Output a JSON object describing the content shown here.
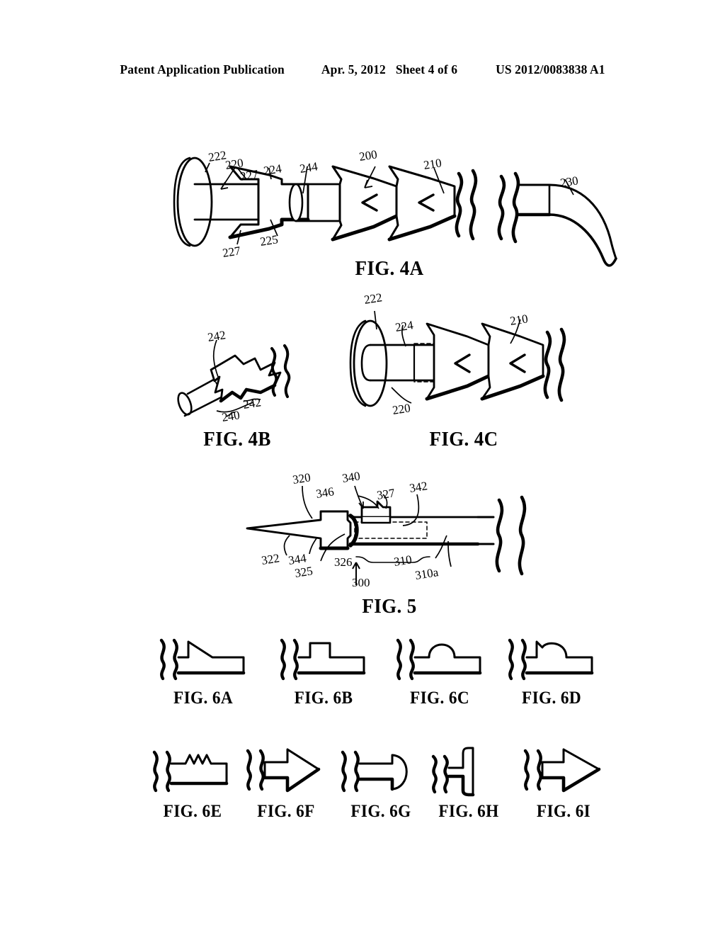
{
  "header": {
    "publication": "Patent Application Publication",
    "date": "Apr. 5, 2012",
    "sheet": "Sheet 4 of 6",
    "patent_number": "US 2012/0083838 A1"
  },
  "document": {
    "type": "patent-drawing-sheet",
    "ink_color": "#000000",
    "background_color": "#ffffff"
  },
  "figures": [
    {
      "id": "fig-4a",
      "caption": "FIG. 4A",
      "description": "Barbed anchor with disc head, shaft and two rearward barbs; separate curved hook element",
      "refs": [
        "222",
        "220",
        "227",
        "224",
        "225",
        "227",
        "244",
        "200",
        "210",
        "230"
      ]
    },
    {
      "id": "fig-4b",
      "caption": "FIG. 4B",
      "description": "Perspective view of barbed tip on a cylindrical shaft",
      "refs": [
        "242",
        "242",
        "240"
      ]
    },
    {
      "id": "fig-4c",
      "caption": "FIG. 4C",
      "description": "Disc head anchor with shaft shown in hidden dashed lines through the barbs",
      "refs": [
        "222",
        "224",
        "220",
        "210"
      ]
    },
    {
      "id": "fig-5",
      "caption": "FIG. 5",
      "description": "Arrow tip anchor with latch tab over an elongated tubular shaft",
      "refs": [
        "320",
        "340",
        "346",
        "327",
        "342",
        "322",
        "344",
        "325",
        "326",
        "300",
        "310",
        "310a"
      ]
    },
    {
      "id": "fig-6a",
      "caption": "FIG. 6A",
      "description": "Ramp / sawtooth profile barb on filament"
    },
    {
      "id": "fig-6b",
      "caption": "FIG. 6B",
      "description": "Rectangular step profile barb on filament"
    },
    {
      "id": "fig-6c",
      "caption": "FIG. 6C",
      "description": "Rounded dome profile barb on filament"
    },
    {
      "id": "fig-6d",
      "caption": "FIG. 6D",
      "description": "Rounded bump with undercut notch profile barb"
    },
    {
      "id": "fig-6e",
      "caption": "FIG. 6E",
      "description": "Serrated sawtooth profile along filament"
    },
    {
      "id": "fig-6f",
      "caption": "FIG. 6F",
      "description": "Solid arrowhead tip on filament"
    },
    {
      "id": "fig-6g",
      "caption": "FIG. 6G",
      "description": "Shaft with rounded mushroom cap tip"
    },
    {
      "id": "fig-6h",
      "caption": "FIG. 6H",
      "description": "Short stem with transverse T-bar anchor"
    },
    {
      "id": "fig-6i",
      "caption": "FIG. 6I",
      "description": "Open outline arrowhead tip on filament"
    }
  ],
  "labels": {
    "fig4a": {
      "r222": "222",
      "r220": "220",
      "r227a": "227",
      "r224": "224",
      "r225": "225",
      "r227b": "227",
      "r244": "244",
      "r200": "200",
      "r210": "210",
      "r230": "230"
    },
    "fig4b": {
      "r242a": "242",
      "r242b": "242",
      "r240": "240"
    },
    "fig4c": {
      "r222": "222",
      "r224": "224",
      "r220": "220",
      "r210": "210"
    },
    "fig5": {
      "r320": "320",
      "r340": "340",
      "r346": "346",
      "r327": "327",
      "r342": "342",
      "r322": "322",
      "r344": "344",
      "r325": "325",
      "r326": "326",
      "r300": "300",
      "r310": "310",
      "r310a": "310a"
    }
  },
  "captions": {
    "fig4a": "FIG. 4A",
    "fig4b": "FIG. 4B",
    "fig4c": "FIG. 4C",
    "fig5": "FIG. 5",
    "fig6a": "FIG. 6A",
    "fig6b": "FIG. 6B",
    "fig6c": "FIG. 6C",
    "fig6d": "FIG. 6D",
    "fig6e": "FIG. 6E",
    "fig6f": "FIG. 6F",
    "fig6g": "FIG. 6G",
    "fig6h": "FIG. 6H",
    "fig6i": "FIG. 6I"
  }
}
